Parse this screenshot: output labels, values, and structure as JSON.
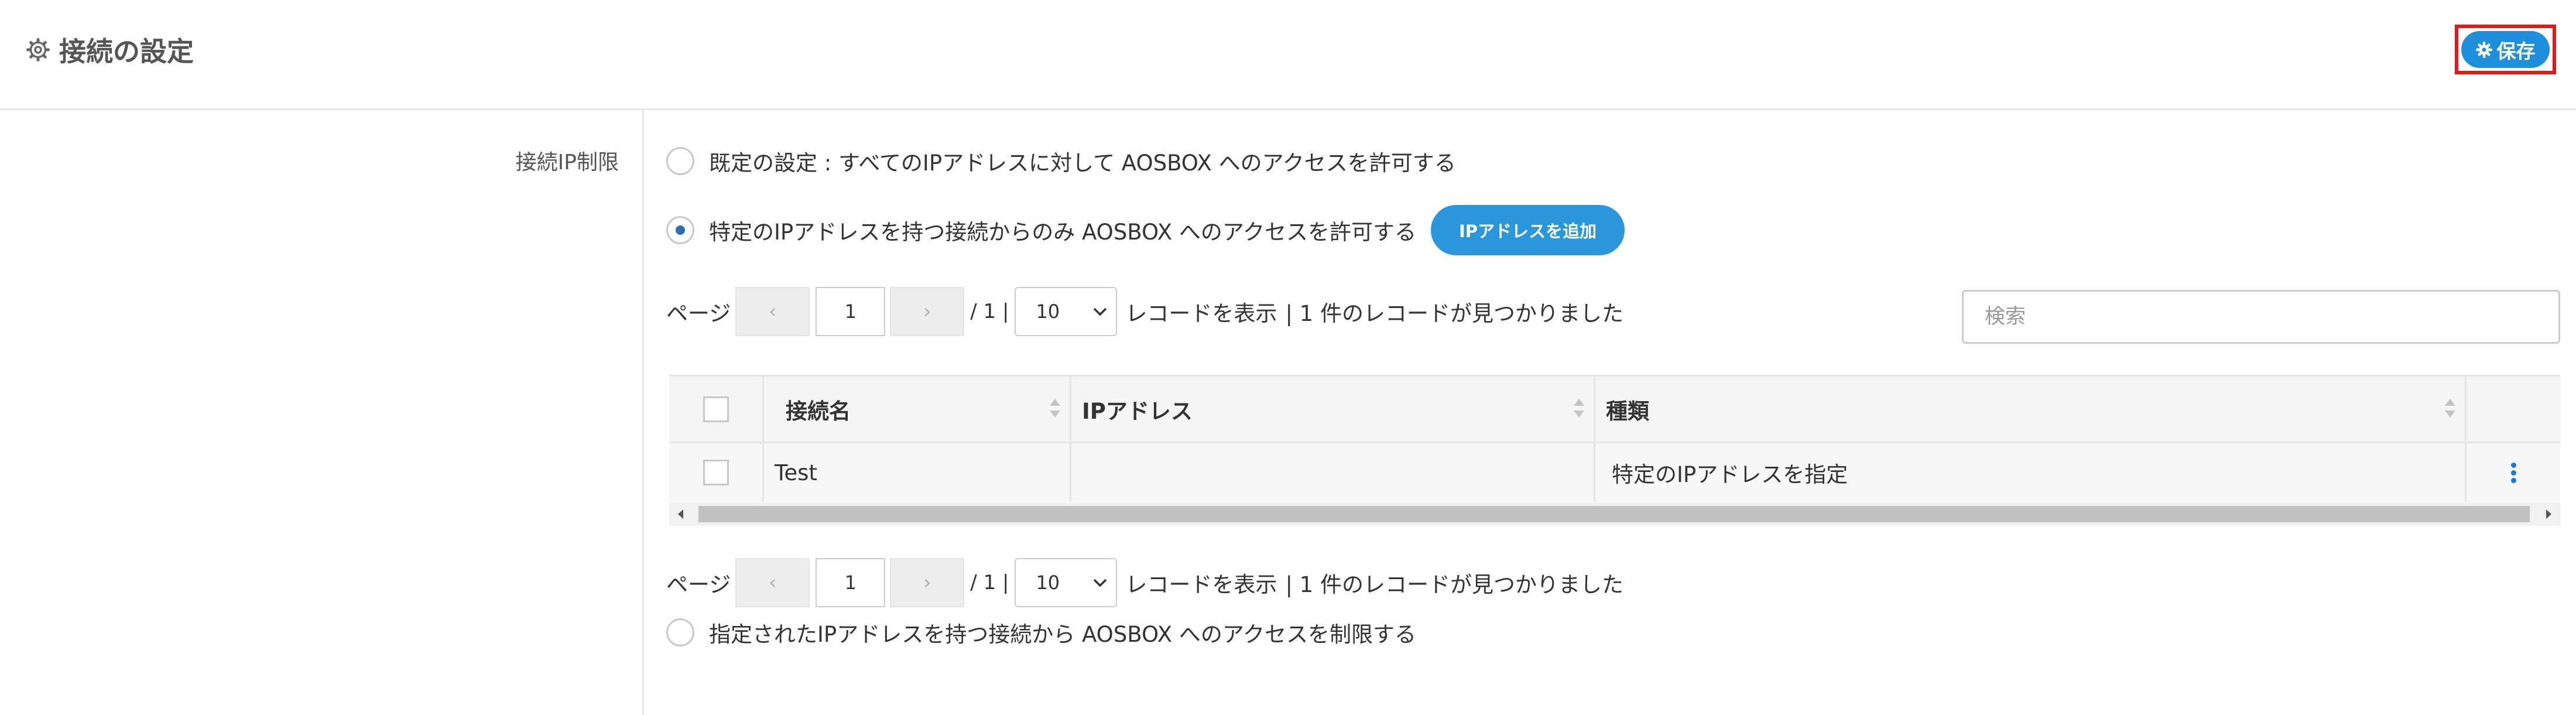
{
  "header": {
    "title": "接続の設定",
    "save_label": "保存"
  },
  "field": {
    "label": "接続IP制限"
  },
  "options": {
    "default": "既定の設定 : すべてのIPアドレスに対して AOSBOX へのアクセスを許可する",
    "specific": "特定のIPアドレスを持つ接続からのみ AOSBOX へのアクセスを許可する",
    "restrict": "指定されたIPアドレスを持つ接続から AOSBOX へのアクセスを制限する",
    "selected": "specific",
    "add_ip_label": "IPアドレスを追加"
  },
  "pager": {
    "page_label": "ページ",
    "prev": "‹",
    "next": "›",
    "current_page": "1",
    "total": "/ 1 |",
    "per_page": "10",
    "show_label": "レコードを表示",
    "found_text": "| 1 件のレコードが見つかりました"
  },
  "search": {
    "placeholder": "検索"
  },
  "table": {
    "headers": [
      "接続名",
      "IPアドレス",
      "種類"
    ],
    "rows": [
      {
        "name": "Test",
        "ip": "",
        "type": "特定のIPアドレスを指定"
      }
    ]
  },
  "colors": {
    "accent": "#1e90db",
    "highlight_border": "#e0191b",
    "kebab": "#1e78d7"
  }
}
